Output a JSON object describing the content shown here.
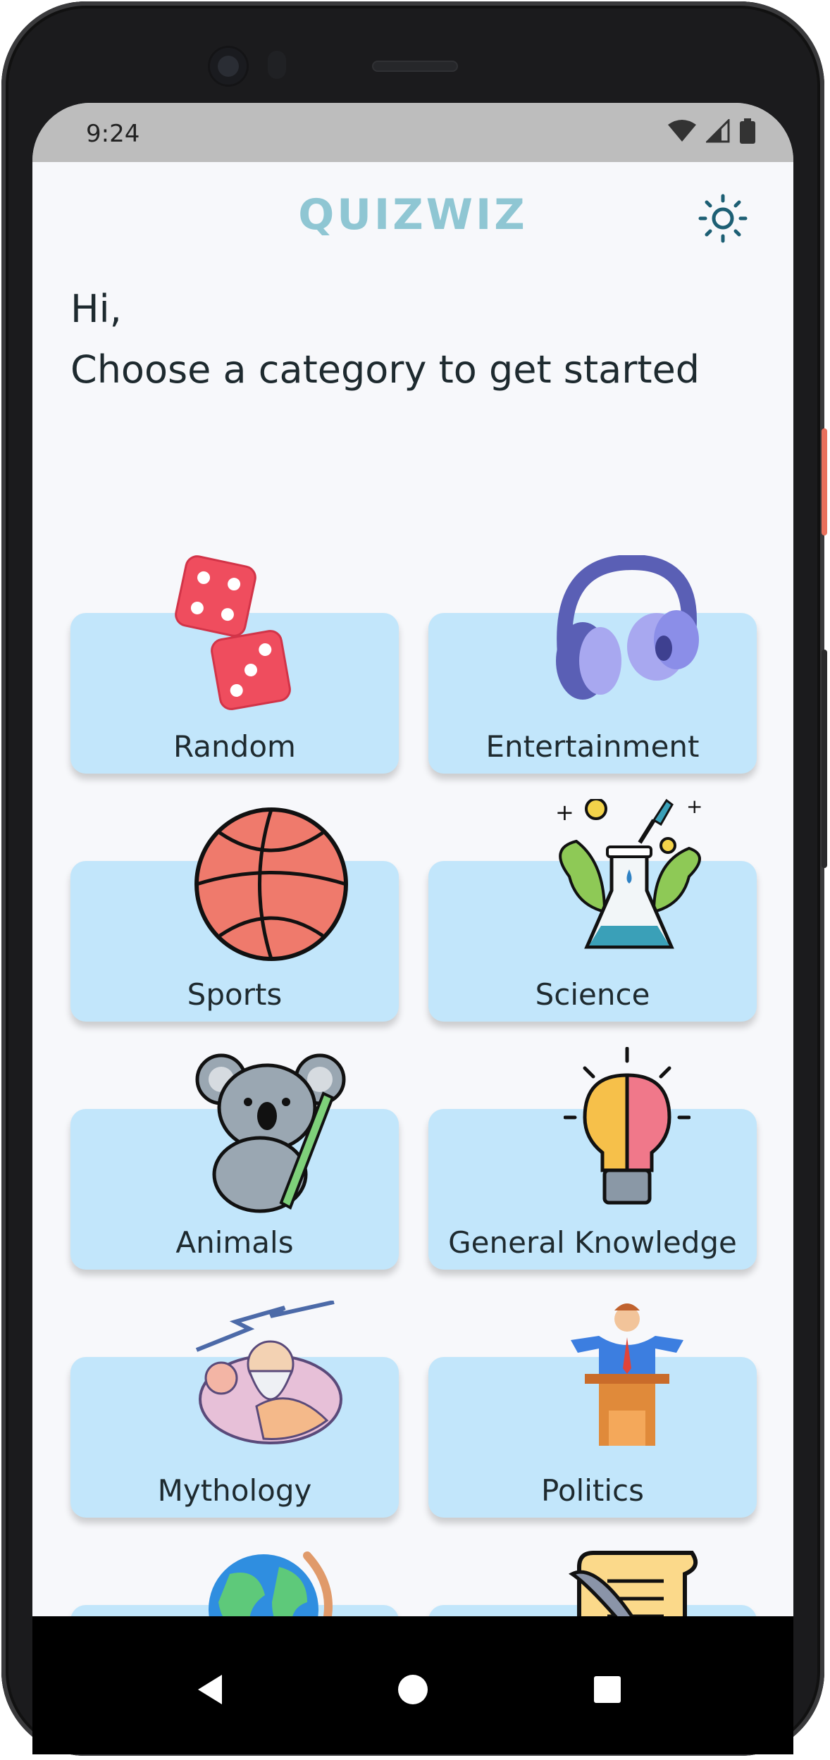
{
  "status_bar": {
    "time": "9:24"
  },
  "app": {
    "title": "QUIZWIZ"
  },
  "header": {
    "greeting": "Hi,",
    "subtitle": "Choose a category to get started"
  },
  "categories": [
    {
      "label": "Random",
      "icon": "dice-icon"
    },
    {
      "label": "Entertainment",
      "icon": "headphones-icon"
    },
    {
      "label": "Sports",
      "icon": "basketball-icon"
    },
    {
      "label": "Science",
      "icon": "flask-icon"
    },
    {
      "label": "Animals",
      "icon": "koala-icon"
    },
    {
      "label": "General Knowledge",
      "icon": "lightbulb-brain-icon"
    },
    {
      "label": "Mythology",
      "icon": "zeus-icon"
    },
    {
      "label": "Politics",
      "icon": "podium-icon"
    },
    {
      "label": "",
      "icon": "globe-icon"
    },
    {
      "label": "",
      "icon": "scroll-icon"
    }
  ],
  "colors": {
    "card_bg": "#c2e6fb",
    "accent": "#1d5f74",
    "logo": "#8fc6d3"
  }
}
